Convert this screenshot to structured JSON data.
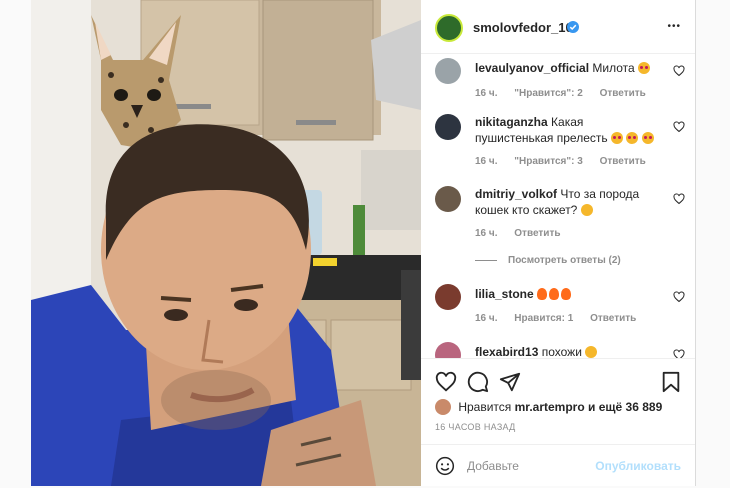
{
  "post": {
    "username": "smolovfedor_10",
    "more_label": "•••"
  },
  "comments": [
    {
      "user": "levaulyanov_official",
      "text": "Милота",
      "time": "16 ч.",
      "likes": "\"Нравится\": 2",
      "reply": "Ответить"
    },
    {
      "user": "nikitaganzha",
      "text": "Какая пушистенькая прелесть",
      "time": "16 ч.",
      "likes": "\"Нравится\": 3",
      "reply": "Ответить"
    },
    {
      "user": "dmitriy_volkof",
      "text": "Что за порода кошек кто скажет?",
      "time": "16 ч.",
      "reply": "Ответить"
    },
    {
      "view_replies": "Посмотреть ответы (2)"
    },
    {
      "user": "lilia_stone",
      "text": "",
      "time": "16 ч.",
      "likes": "Нравится: 1",
      "reply": "Ответить"
    },
    {
      "user": "flexabird13",
      "text": "похожи"
    }
  ],
  "likes": {
    "prefix": "Нравится",
    "user": "mr.artempro",
    "suffix": "и ещё 36 889"
  },
  "timestamp": "16 ЧАСОВ НАЗАД",
  "add_comment": {
    "placeholder": "Добавьте",
    "publish_label": "Опубликовать"
  },
  "colors": {
    "verified": "#3897f0",
    "publish_disabled": "#b2dffc",
    "meta": "#8e8e8e"
  },
  "icons": [
    "heart-icon",
    "comment-icon",
    "share-icon",
    "bookmark-icon",
    "emoji-icon",
    "verified-icon",
    "more-icon"
  ]
}
